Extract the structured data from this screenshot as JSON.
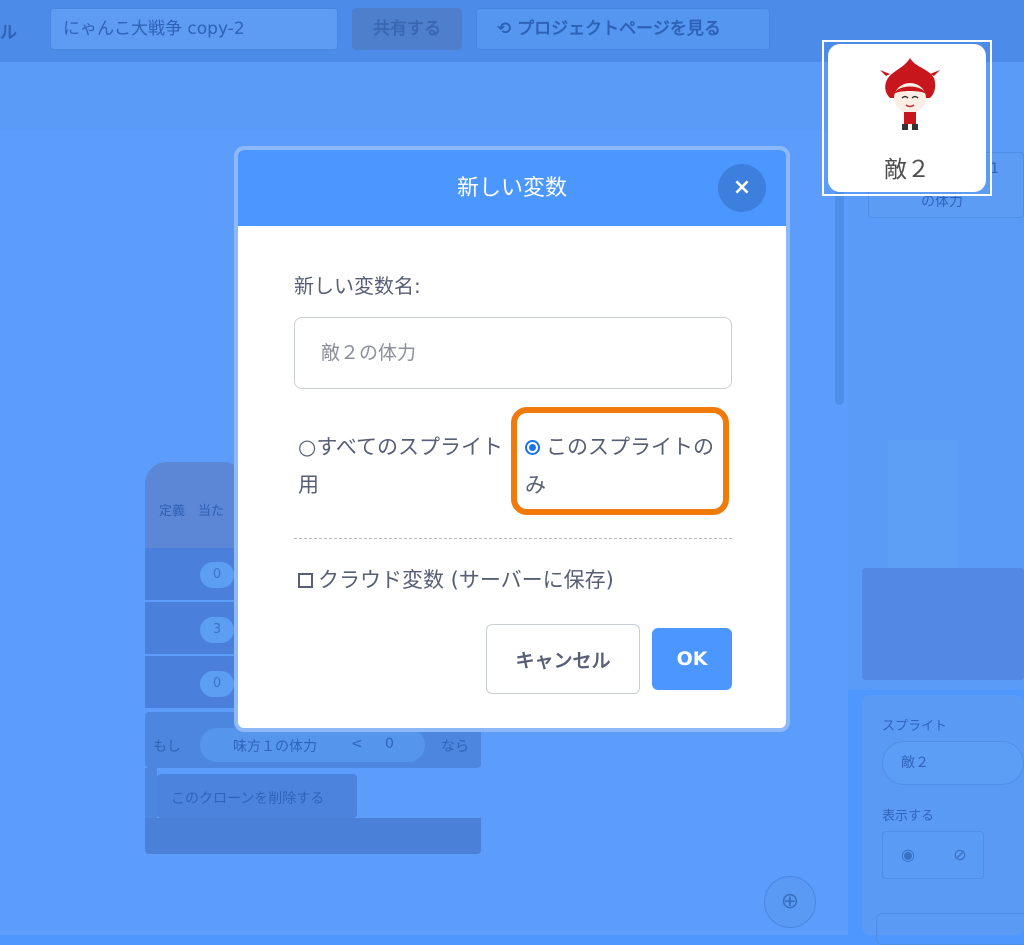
{
  "menubar": {
    "edge_fragment": "ル",
    "project_title": "にゃんこ大戦争 copy-2",
    "share_label": "共有する",
    "project_page_label": "プロジェクトページを見る"
  },
  "background_script": {
    "define_label": "定義　当た",
    "values": [
      "0",
      "3",
      "0"
    ],
    "if_label": "もし",
    "condition_var": "味方１の体力",
    "condition_op": "<",
    "condition_value": "0",
    "then_label": "なら",
    "delete_clone_label": "このクローンを削除する"
  },
  "stage": {
    "var_label": "の体力",
    "var_value": "1"
  },
  "sprite_info": {
    "sprite_label": "スプライト",
    "sprite_name": "敵２",
    "show_label": "表示する"
  },
  "sprite_card": {
    "name": "敵２"
  },
  "modal": {
    "title": "新しい変数",
    "close_glyph": "×",
    "name_label": "新しい変数名:",
    "name_placeholder": "敵２の体力",
    "radio_all_label": "すべてのスプライト用",
    "radio_all_selected": false,
    "radio_this_label": "このスプライトのみ",
    "radio_this_selected": true,
    "cloud_label": "クラウド変数 (サーバーに保存)",
    "cloud_checked": false,
    "cancel_label": "キャンセル",
    "ok_label": "OK"
  },
  "colors": {
    "accent": "#4c97ff",
    "highlight": "#f07a0a",
    "text": "#575e75"
  }
}
